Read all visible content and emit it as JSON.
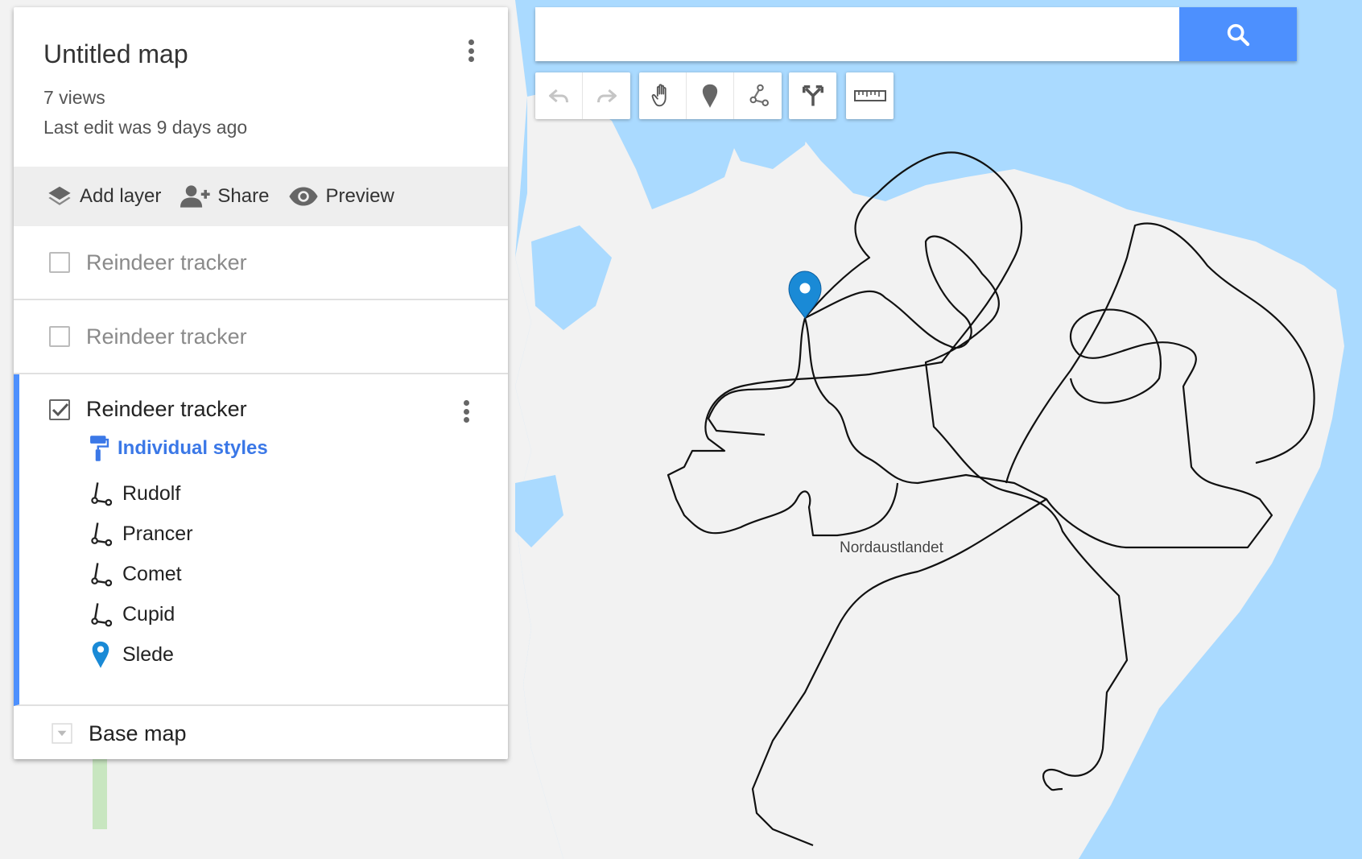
{
  "map_info": {
    "title": "Untitled map",
    "views": "7 views",
    "last_edit": "Last edit was 9 days ago"
  },
  "actions": {
    "add_layer": "Add layer",
    "share": "Share",
    "preview": "Preview"
  },
  "layers": [
    {
      "name": "Reindeer tracker",
      "checked": false
    },
    {
      "name": "Reindeer tracker",
      "checked": false
    },
    {
      "name": "Reindeer tracker",
      "checked": true
    }
  ],
  "active_layer": {
    "style_label": "Individual styles",
    "items": [
      {
        "label": "Rudolf",
        "icon": "line-icon"
      },
      {
        "label": "Prancer",
        "icon": "line-icon"
      },
      {
        "label": "Comet",
        "icon": "line-icon"
      },
      {
        "label": "Cupid",
        "icon": "line-icon"
      },
      {
        "label": "Slede",
        "icon": "marker-icon"
      }
    ]
  },
  "base_map": {
    "label": "Base map"
  },
  "search": {
    "placeholder": "",
    "value": ""
  },
  "map": {
    "place_label": "Nordaustlandet"
  },
  "colors": {
    "accent": "#4d90fe",
    "water": "#aadaff",
    "land": "#f2f2f2",
    "marker": "#1a8ad6",
    "styles_link": "#3b78e7"
  }
}
